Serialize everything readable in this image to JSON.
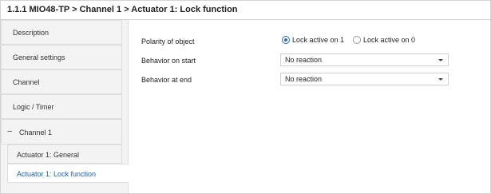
{
  "window": {
    "title": "1.1.1 MIO48-TP > Channel 1 > Actuator 1: Lock function"
  },
  "sidebar": {
    "items": [
      {
        "label": "Description"
      },
      {
        "label": "General settings"
      },
      {
        "label": "Channel"
      },
      {
        "label": "Logic / Timer"
      }
    ],
    "group": {
      "label": "Channel 1",
      "expander": "−"
    },
    "subitems": [
      {
        "label": "Actuator 1: General"
      },
      {
        "label": "Actuator 1: Lock function",
        "active": true
      }
    ]
  },
  "main": {
    "polarity": {
      "label": "Polarity of object",
      "options": [
        "Lock active on 1",
        "Lock active on 0"
      ],
      "selected": "Lock active on 1"
    },
    "behavior_start": {
      "label": "Behavior on start",
      "value": "No reaction"
    },
    "behavior_end": {
      "label": "Behavior at end",
      "value": "No reaction"
    }
  },
  "colors": {
    "accent": "#1f5fa6",
    "radio_selected": "#2a6dc2",
    "sidebar_bg": "#f3f3f3"
  }
}
